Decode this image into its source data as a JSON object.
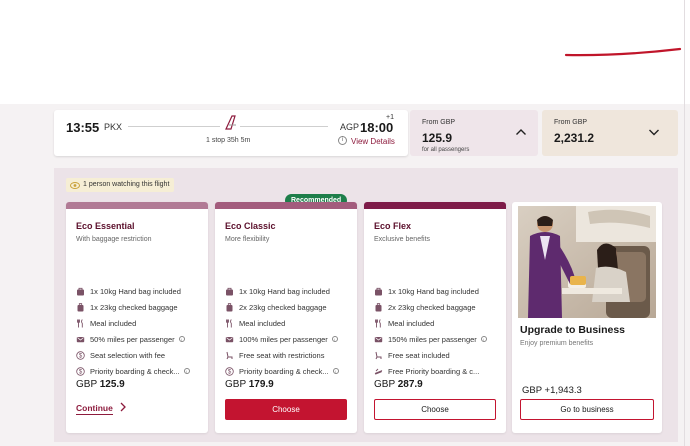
{
  "flight": {
    "dep_time": "13:55",
    "dep_code": "PKX",
    "arr_code": "AGP",
    "arr_time": "18:00",
    "plus_day": "+1",
    "stop_info": "1 stop 35h 5m",
    "view_details": "View Details"
  },
  "price_summary": [
    {
      "from": "From GBP",
      "amount": "125.9",
      "sub": "for all passengers",
      "chevron": "chevron-up-icon"
    },
    {
      "from": "From GBP",
      "amount": "2,231.2",
      "chevron": "chevron-down-icon"
    }
  ],
  "watching": "1 person watching this flight",
  "recommended_badge": "Recommended",
  "fares": [
    {
      "title": "Eco Essential",
      "subtitle": "With baggage restriction",
      "features": [
        {
          "icon": "handbag-icon",
          "text": "1x 10kg Hand bag included"
        },
        {
          "icon": "suitcase-icon",
          "text": "1x 23kg checked baggage"
        },
        {
          "icon": "cutlery-icon",
          "text": "Meal included"
        },
        {
          "icon": "miles-icon",
          "text": "50% miles per passenger"
        },
        {
          "icon": "dollar-icon",
          "text": "Seat selection with fee"
        },
        {
          "icon": "dollar-icon",
          "text": "Priority boarding & check..."
        }
      ],
      "currency": "GBP",
      "price": "125.9",
      "action": "Continue"
    },
    {
      "title": "Eco Classic",
      "subtitle": "More flexibility",
      "features": [
        {
          "icon": "handbag-icon",
          "text": "1x 10kg Hand bag included"
        },
        {
          "icon": "suitcase-icon",
          "text": "2x 23kg checked baggage"
        },
        {
          "icon": "cutlery-icon",
          "text": "Meal included"
        },
        {
          "icon": "miles-icon",
          "text": "100% miles per passenger"
        },
        {
          "icon": "seat-icon",
          "text": "Free seat with restrictions"
        },
        {
          "icon": "dollar-icon",
          "text": "Priority boarding & check..."
        }
      ],
      "currency": "GBP",
      "price": "179.9",
      "action": "Choose"
    },
    {
      "title": "Eco Flex",
      "subtitle": "Exclusive benefits",
      "features": [
        {
          "icon": "handbag-icon",
          "text": "1x 10kg Hand bag included"
        },
        {
          "icon": "suitcase-icon",
          "text": "2x 23kg checked baggage"
        },
        {
          "icon": "cutlery-icon",
          "text": "Meal included"
        },
        {
          "icon": "miles-icon",
          "text": "150% miles per passenger"
        },
        {
          "icon": "seat-icon",
          "text": "Free seat included"
        },
        {
          "icon": "priority-icon",
          "text": "Free Priority boarding & c..."
        }
      ],
      "currency": "GBP",
      "price": "287.9",
      "action": "Choose"
    }
  ],
  "business": {
    "title": "Upgrade to Business",
    "subtitle": "Enjoy premium benefits",
    "price": "GBP +1,943.3",
    "action": "Go to business"
  },
  "colors": {
    "brand": "#8d1b3d",
    "button_red": "#c31430",
    "recommended_green": "#1e7e4a",
    "essential_bar": "#b17a95",
    "classic_bar": "#a35c7d",
    "flex_bar": "#7e1c49"
  }
}
